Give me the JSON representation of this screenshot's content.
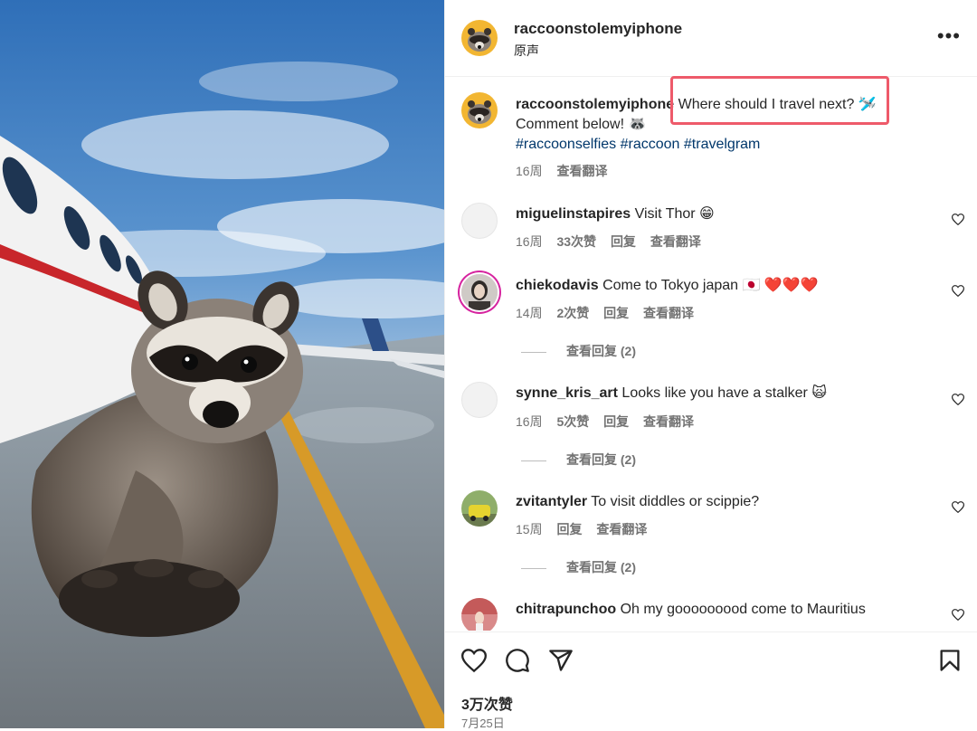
{
  "header": {
    "username": "raccoonstolemyiphone",
    "audio": "原声",
    "more_icon": "more-horizontal-icon"
  },
  "caption": {
    "username": "raccoonstolemyiphone",
    "text_line1": "Where should I travel next? 🛩️",
    "text_line2": "Comment below! 🦝",
    "hashtags": [
      "#raccoonselfies",
      "#raccoon",
      "#travelgram"
    ],
    "time": "16周",
    "translate": "查看翻译"
  },
  "comments": [
    {
      "username": "miguelinstapires",
      "text": "Visit Thor 😁",
      "time": "16周",
      "likes": "33次赞",
      "reply": "回复",
      "translate": "查看翻译",
      "view_replies": ""
    },
    {
      "username": "chiekodavis",
      "text": "Come to Tokyo japan 🇯🇵 ❤️❤️❤️",
      "time": "14周",
      "likes": "2次赞",
      "reply": "回复",
      "translate": "查看翻译",
      "view_replies": "查看回复 (2)"
    },
    {
      "username": "synne_kris_art",
      "text": "Looks like you have a stalker 🙀",
      "time": "16周",
      "likes": "5次赞",
      "reply": "回复",
      "translate": "查看翻译",
      "view_replies": "查看回复 (2)"
    },
    {
      "username": "zvitantyler",
      "text": "To visit diddles or scippie?",
      "time": "15周",
      "likes": "",
      "reply": "回复",
      "translate": "查看翻译",
      "view_replies": "查看回复 (2)"
    },
    {
      "username": "chitrapunchoo",
      "text": "Oh my gooooooood come to Mauritius",
      "time": "",
      "likes": "",
      "reply": "",
      "translate": "",
      "view_replies": ""
    }
  ],
  "actions": {
    "like_icon": "heart-icon",
    "comment_icon": "comment-icon",
    "share_icon": "paper-plane-icon",
    "save_icon": "bookmark-icon",
    "likes_count": "3万次赞",
    "date": "7月25日"
  },
  "colors": {
    "highlight": "#ee5a6a",
    "hashtag": "#00376b",
    "story_ring": "#d6249f",
    "muted": "#737373"
  }
}
